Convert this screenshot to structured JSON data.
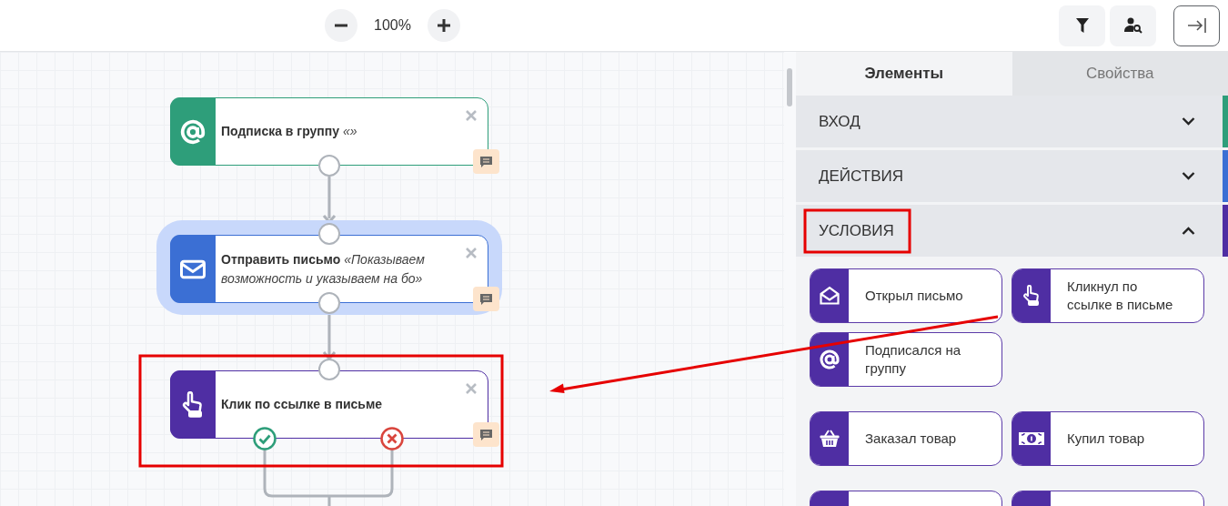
{
  "toolbar": {
    "zoom_level": "100%"
  },
  "canvas": {
    "nodes": [
      {
        "kind": "subscription",
        "color": "#2e9e7a",
        "title": "Подписка в группу",
        "subtitle": "«»",
        "selected": false
      },
      {
        "kind": "email",
        "color": "#3b6fd4",
        "title": "Отправить письмо",
        "subtitle": "«Показываем возможность и указываем на бо»",
        "selected": true
      },
      {
        "kind": "click",
        "color": "#4f2ea3",
        "title": "Клик по ссылке в письме",
        "selected": false
      }
    ]
  },
  "panel": {
    "tabs": [
      {
        "label": "Элементы",
        "selected": true
      },
      {
        "label": "Свойства",
        "selected": false
      }
    ],
    "sections": [
      {
        "label": "ВХОД",
        "expanded": false,
        "color": "#2e9e7a"
      },
      {
        "label": "ДЕЙСТВИЯ",
        "expanded": false,
        "color": "#3b6fd4"
      },
      {
        "label": "УСЛОВИЯ",
        "expanded": true,
        "color": "#4f2ea3"
      }
    ],
    "element_groups": [
      [
        {
          "kind": "opened",
          "label": "Открыл письмо"
        },
        {
          "kind": "click",
          "label": "Кликнул по ссылке в письме"
        },
        {
          "kind": "subscription",
          "label": "Подписался на группу"
        }
      ],
      [
        {
          "kind": "ordered",
          "label": "Заказал товар"
        },
        {
          "kind": "bought",
          "label": "Купил товар"
        }
      ],
      [
        {
          "kind": "cut"
        },
        {
          "kind": "cut"
        }
      ]
    ]
  }
}
